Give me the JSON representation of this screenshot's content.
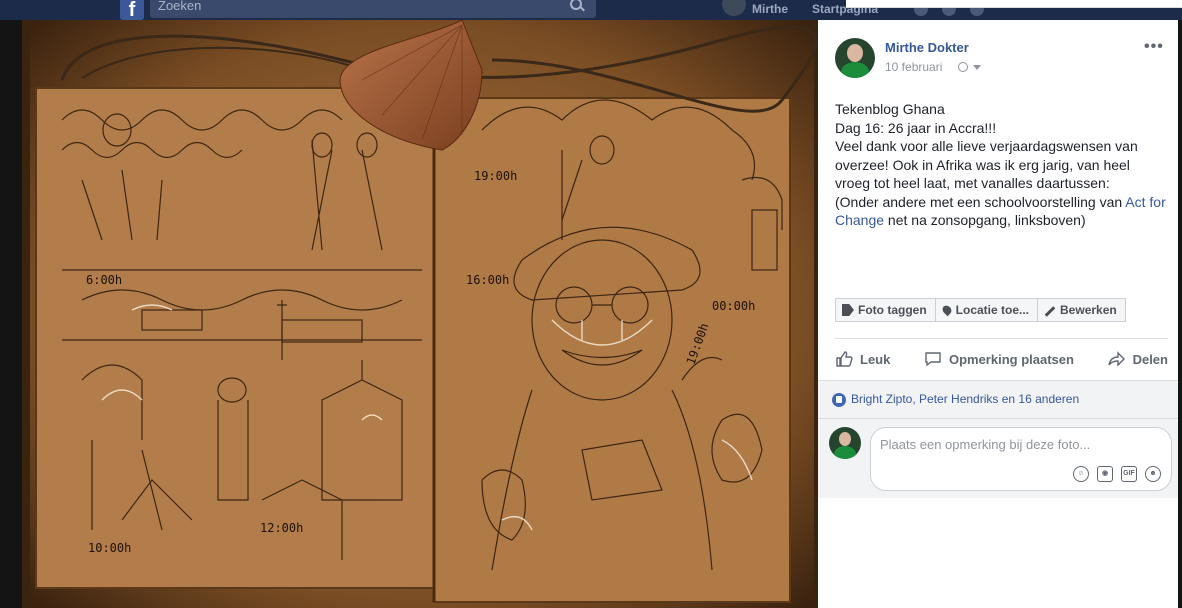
{
  "topbar": {
    "search_placeholder": "Zoeken",
    "user_name": "Mirthe",
    "start_label": "Startpagina"
  },
  "post": {
    "author": "Mirthe Dokter",
    "date": "10 februari",
    "text_lines": [
      "Tekenblog Ghana",
      "Dag 16: 26 jaar in Accra!!!",
      "Veel dank voor alle lieve verjaardagswensen van overzee! Ook in Afrika was ik erg jarig, van heel vroeg tot heel laat, met vanalles daartussen:"
    ],
    "text_last_prefix": "(Onder andere met een schoolvoorstelling van ",
    "text_link": "Act for Change",
    "text_last_suffix": " net na zonsopgang, linksboven)"
  },
  "photo_actions": {
    "tag": "Foto taggen",
    "location": "Locatie toe...",
    "edit": "Bewerken"
  },
  "reactions": {
    "like": "Leuk",
    "comment": "Opmerking plaatsen",
    "share": "Delen"
  },
  "likes_summary": "Bright Zipto, Peter Hendriks en 16 anderen",
  "comment_placeholder": "Plaats een opmerking bij deze foto...",
  "icons": {
    "more": "more-icon",
    "globe": "globe-icon"
  },
  "photo_labels": [
    "6:00h",
    "10:00h",
    "12:00h",
    "16:00h",
    "19:00h",
    "00:00h",
    "19:00h"
  ]
}
